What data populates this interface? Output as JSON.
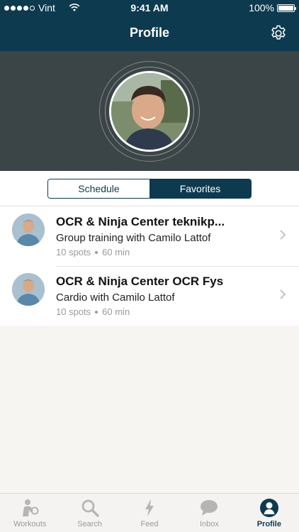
{
  "status": {
    "carrier": "Vint",
    "time": "9:41 AM",
    "battery": "100%"
  },
  "nav": {
    "title": "Profile",
    "settings_icon": "gear-icon"
  },
  "segment": {
    "schedule": "Schedule",
    "favorites": "Favorites",
    "selected": "Favorites"
  },
  "classes": [
    {
      "title": "OCR & Ninja Center teknikp...",
      "subtitle": "Group training with Camilo Lattof",
      "spots": "10 spots",
      "duration": "60 min"
    },
    {
      "title": "OCR & Ninja Center OCR Fys",
      "subtitle": "Cardio with Camilo Lattof",
      "spots": "10 spots",
      "duration": "60 min"
    }
  ],
  "tabs": [
    {
      "label": "Workouts",
      "icon": "workouts-icon"
    },
    {
      "label": "Search",
      "icon": "search-icon"
    },
    {
      "label": "Feed",
      "icon": "lightning-icon"
    },
    {
      "label": "Inbox",
      "icon": "chat-bubble-icon"
    },
    {
      "label": "Profile",
      "icon": "profile-icon",
      "active": true
    }
  ],
  "colors": {
    "primary": "#0d3a4f",
    "hero_bg": "#3b4447",
    "muted": "#9b9b9b"
  }
}
